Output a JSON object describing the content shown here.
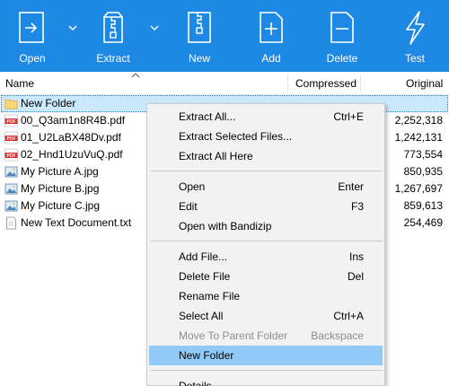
{
  "toolbar": {
    "buttons": [
      {
        "label": "Open",
        "icon": "open-icon"
      },
      {
        "label": "Extract",
        "icon": "extract-icon"
      },
      {
        "label": "New",
        "icon": "new-archive-icon"
      },
      {
        "label": "Add",
        "icon": "add-file-icon"
      },
      {
        "label": "Delete",
        "icon": "delete-file-icon"
      },
      {
        "label": "Test",
        "icon": "test-lightning-icon"
      }
    ]
  },
  "columns": {
    "name": "Name",
    "compressed": "Compressed",
    "original": "Original"
  },
  "files": [
    {
      "name": "New Folder",
      "size": "",
      "type": "folder"
    },
    {
      "name": "00_Q3am1n8R4B.pdf",
      "size": "2,252,318",
      "type": "pdf"
    },
    {
      "name": "01_U2LaBX48Dv.pdf",
      "size": "1,242,131",
      "type": "pdf"
    },
    {
      "name": "02_Hnd1UzuVuQ.pdf",
      "size": "773,554",
      "type": "pdf"
    },
    {
      "name": "My Picture A.jpg",
      "size": "850,935",
      "type": "image"
    },
    {
      "name": "My Picture B.jpg",
      "size": "1,267,697",
      "type": "image"
    },
    {
      "name": "My Picture C.jpg",
      "size": "859,613",
      "type": "image"
    },
    {
      "name": "New Text Document.txt",
      "size": "254,469",
      "type": "text"
    }
  ],
  "pdf_badge": "PDF",
  "context_menu": {
    "groups": [
      [
        {
          "label": "Extract All...",
          "shortcut": "Ctrl+E"
        },
        {
          "label": "Extract Selected Files...",
          "shortcut": ""
        },
        {
          "label": "Extract All Here",
          "shortcut": ""
        }
      ],
      [
        {
          "label": "Open",
          "shortcut": "Enter"
        },
        {
          "label": "Edit",
          "shortcut": "F3"
        },
        {
          "label": "Open with Bandizip",
          "shortcut": ""
        }
      ],
      [
        {
          "label": "Add File...",
          "shortcut": "Ins"
        },
        {
          "label": "Delete File",
          "shortcut": "Del"
        },
        {
          "label": "Rename File",
          "shortcut": ""
        },
        {
          "label": "Select All",
          "shortcut": "Ctrl+A"
        },
        {
          "label": "Move To Parent Folder",
          "shortcut": "Backspace",
          "disabled": true
        },
        {
          "label": "New Folder",
          "shortcut": "",
          "highlighted": true
        }
      ],
      [
        {
          "label": "Details",
          "shortcut": ""
        }
      ]
    ]
  },
  "colors": {
    "toolbar_bg": "#1e88e5",
    "selection_bg": "#cce8ff",
    "menu_highlight": "#91c9f7",
    "menu_bg": "#f2f2f2",
    "pdf_red": "#d32f2f",
    "folder_yellow": "#f8d775"
  }
}
